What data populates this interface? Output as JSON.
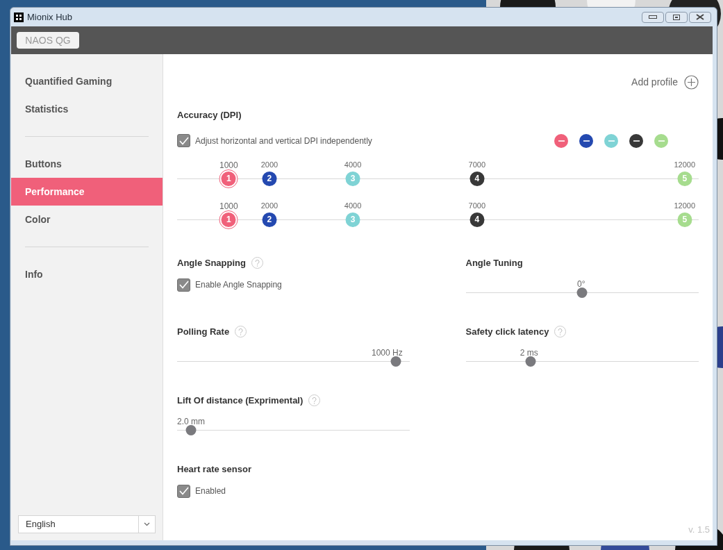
{
  "window": {
    "title": "Mionix Hub"
  },
  "device_tab": {
    "label": "NAOS QG"
  },
  "sidebar": {
    "groups": [
      [
        {
          "label": "Quantified Gaming",
          "selected": false
        },
        {
          "label": "Statistics",
          "selected": false
        }
      ],
      [
        {
          "label": "Buttons",
          "selected": false
        },
        {
          "label": "Performance",
          "selected": true
        },
        {
          "label": "Color",
          "selected": false
        }
      ],
      [
        {
          "label": "Info",
          "selected": false
        }
      ]
    ]
  },
  "language": {
    "value": "English"
  },
  "add_profile": {
    "label": "Add profile"
  },
  "accuracy": {
    "title": "Accuracy (DPI)",
    "independent": {
      "label": "Adjust horizontal and vertical DPI independently",
      "checked": true
    },
    "profile_colors": [
      {
        "color": "#f0607a"
      },
      {
        "color": "#2449b0"
      },
      {
        "color": "#7fd3d5"
      },
      {
        "color": "#383838"
      },
      {
        "color": "#a6dc8e"
      }
    ],
    "axes": [
      {
        "marks": [
          {
            "number": "1",
            "value": "1000",
            "level": 0.099,
            "color": "#f0607a",
            "selected": true
          },
          {
            "number": "2",
            "value": "2000",
            "level": 0.177,
            "color": "#2449b0",
            "selected": false
          },
          {
            "number": "3",
            "value": "4000",
            "level": 0.337,
            "color": "#7fd3d5",
            "selected": false
          },
          {
            "number": "4",
            "value": "7000",
            "level": 0.575,
            "color": "#383838",
            "selected": false
          },
          {
            "number": "5",
            "value": "12000",
            "level": 0.973,
            "color": "#a6dc8e",
            "selected": false
          }
        ]
      },
      {
        "marks": [
          {
            "number": "1",
            "value": "1000",
            "level": 0.099,
            "color": "#f0607a",
            "selected": true
          },
          {
            "number": "2",
            "value": "2000",
            "level": 0.177,
            "color": "#2449b0",
            "selected": false
          },
          {
            "number": "3",
            "value": "4000",
            "level": 0.337,
            "color": "#7fd3d5",
            "selected": false
          },
          {
            "number": "4",
            "value": "7000",
            "level": 0.575,
            "color": "#383838",
            "selected": false
          },
          {
            "number": "5",
            "value": "12000",
            "level": 0.973,
            "color": "#a6dc8e",
            "selected": false
          }
        ]
      }
    ]
  },
  "settings_rows": [
    [
      {
        "kind": "checkbox",
        "title": "Angle Snapping",
        "help": true,
        "label": "Enable Angle Snapping",
        "checked": true
      },
      {
        "kind": "slider",
        "title": "Angle Tuning",
        "help": false,
        "reading": "0°",
        "level": 0.5
      }
    ],
    [
      {
        "kind": "slider",
        "title": "Polling Rate",
        "help": true,
        "reading": "1000 Hz",
        "level": 0.94
      },
      {
        "kind": "slider",
        "title": "Safety click latency",
        "help": true,
        "reading": "2 ms",
        "level": 0.28
      }
    ],
    [
      {
        "kind": "slider",
        "title": "Lift Of distance (Exprimental)",
        "help": true,
        "reading": "2.0 mm",
        "level": 0.06
      }
    ],
    [
      {
        "kind": "checkbox",
        "title": "Heart rate sensor",
        "help": false,
        "label": "Enabled",
        "checked": true
      }
    ]
  ],
  "version": "v. 1.5"
}
